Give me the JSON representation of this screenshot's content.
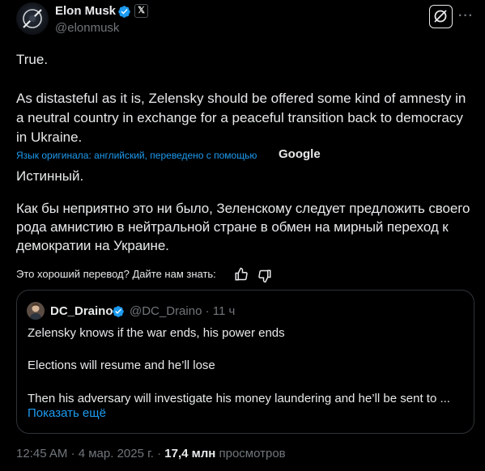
{
  "author": {
    "name": "Elon Musk",
    "handle": "@elonmusk",
    "affiliation_badge": "𝕏"
  },
  "post": {
    "original_para1": "True.",
    "original_para2": "As distasteful as it is, Zelensky should be offered some kind of amnesty in a neutral country in exchange for a peaceful transition back to democracy in Ukraine.",
    "translation_note": "Язык оригинала: английский, переведено с помощью",
    "translation_provider": "Google",
    "translated_para1": "Истинный.",
    "translated_para2": "Как бы неприятно это ни было, Зеленскому следует предложить своего рода амнистию в нейтральной стране в обмен на мирный переход к демократии на Украине."
  },
  "feedback": {
    "prompt": "Это хороший перевод? Дайте нам знать:"
  },
  "quote": {
    "name": "DC_Draino",
    "handle": "@DC_Draino",
    "separator": "·",
    "time": "11 ч",
    "line1": "Zelensky knows if the war ends, his power ends",
    "line2": "Elections will resume and he’ll lose",
    "line3": "Then his adversary will investigate his money laundering and he’ll be sent to ...",
    "show_more": "Показать ещё"
  },
  "footer": {
    "time": "12:45 AM",
    "separator": "·",
    "date": "4 мар. 2025 г.",
    "views_count": "17,4 млн",
    "views_label": "просмотров"
  },
  "icons": [
    "verified-badge-icon",
    "grok-icon",
    "more-icon",
    "thumbs-up-icon",
    "thumbs-down-icon"
  ],
  "colors": {
    "accent": "#1d9bf0",
    "muted": "#71767b",
    "text": "#e7e9ea",
    "background": "#000000",
    "border": "#2f3336"
  }
}
